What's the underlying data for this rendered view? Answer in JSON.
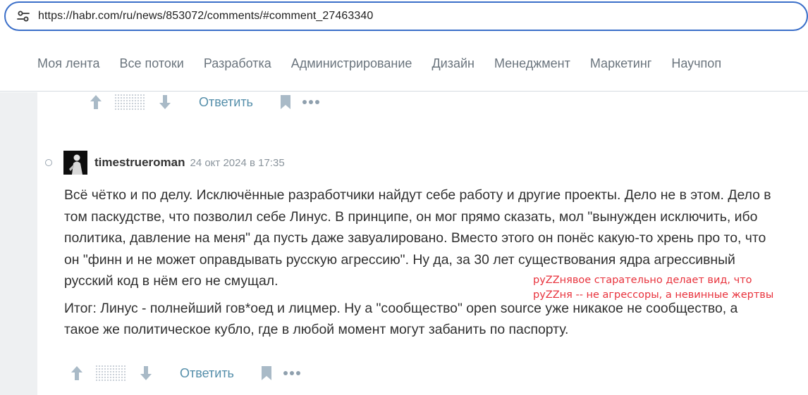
{
  "browser": {
    "url": "https://habr.com/ru/news/853072/comments/#comment_27463340",
    "site_info_icon": "tune-icon",
    "accent_color": "#3b6fc9"
  },
  "nav": {
    "items": [
      "Моя лента",
      "Все потоки",
      "Разработка",
      "Администрирование",
      "Дизайн",
      "Менеджмент",
      "Маркетинг",
      "Научпоп"
    ]
  },
  "prev_comment_actions": {
    "reply_label": "Ответить"
  },
  "comment": {
    "username": "timestrueroman",
    "timestamp": "24 окт 2024 в 17:35",
    "paragraphs": [
      "Всё чётко и по делу. Исключённые разработчики найдут себе работу и другие проекты. Дело не в этом. Дело в том паскудстве, что позволил себе Линус. В принципе, он мог прямо сказать, мол \"вынужден исключить, ибо политика, давление на меня\" да пусть даже завуалировано. Вместо этого он понёс какую-то хрень про то, что он \"финн и не может оправдывать русскую агрессию\". Ну да, за 30 лет существования ядра агрессивный русский код в нём его не смущал.",
      "Итог: Линус - полнейший гов*оед и лицмер. Ну а \"сообщество\" open source уже никакое не сообщество, а такое же политическое кубло, где в любой момент могут забанить по паспорту."
    ],
    "reply_label": "Ответить"
  },
  "annotation": {
    "lines": [
      "руZZнявое старательно делает вид, что",
      "руZZня -- не агрессоры, а невинные жертвы"
    ],
    "color": "#e8323c"
  },
  "colors": {
    "link": "#548eaa",
    "icon": "#8fa0ae",
    "page_bg": "#eef0f2"
  }
}
